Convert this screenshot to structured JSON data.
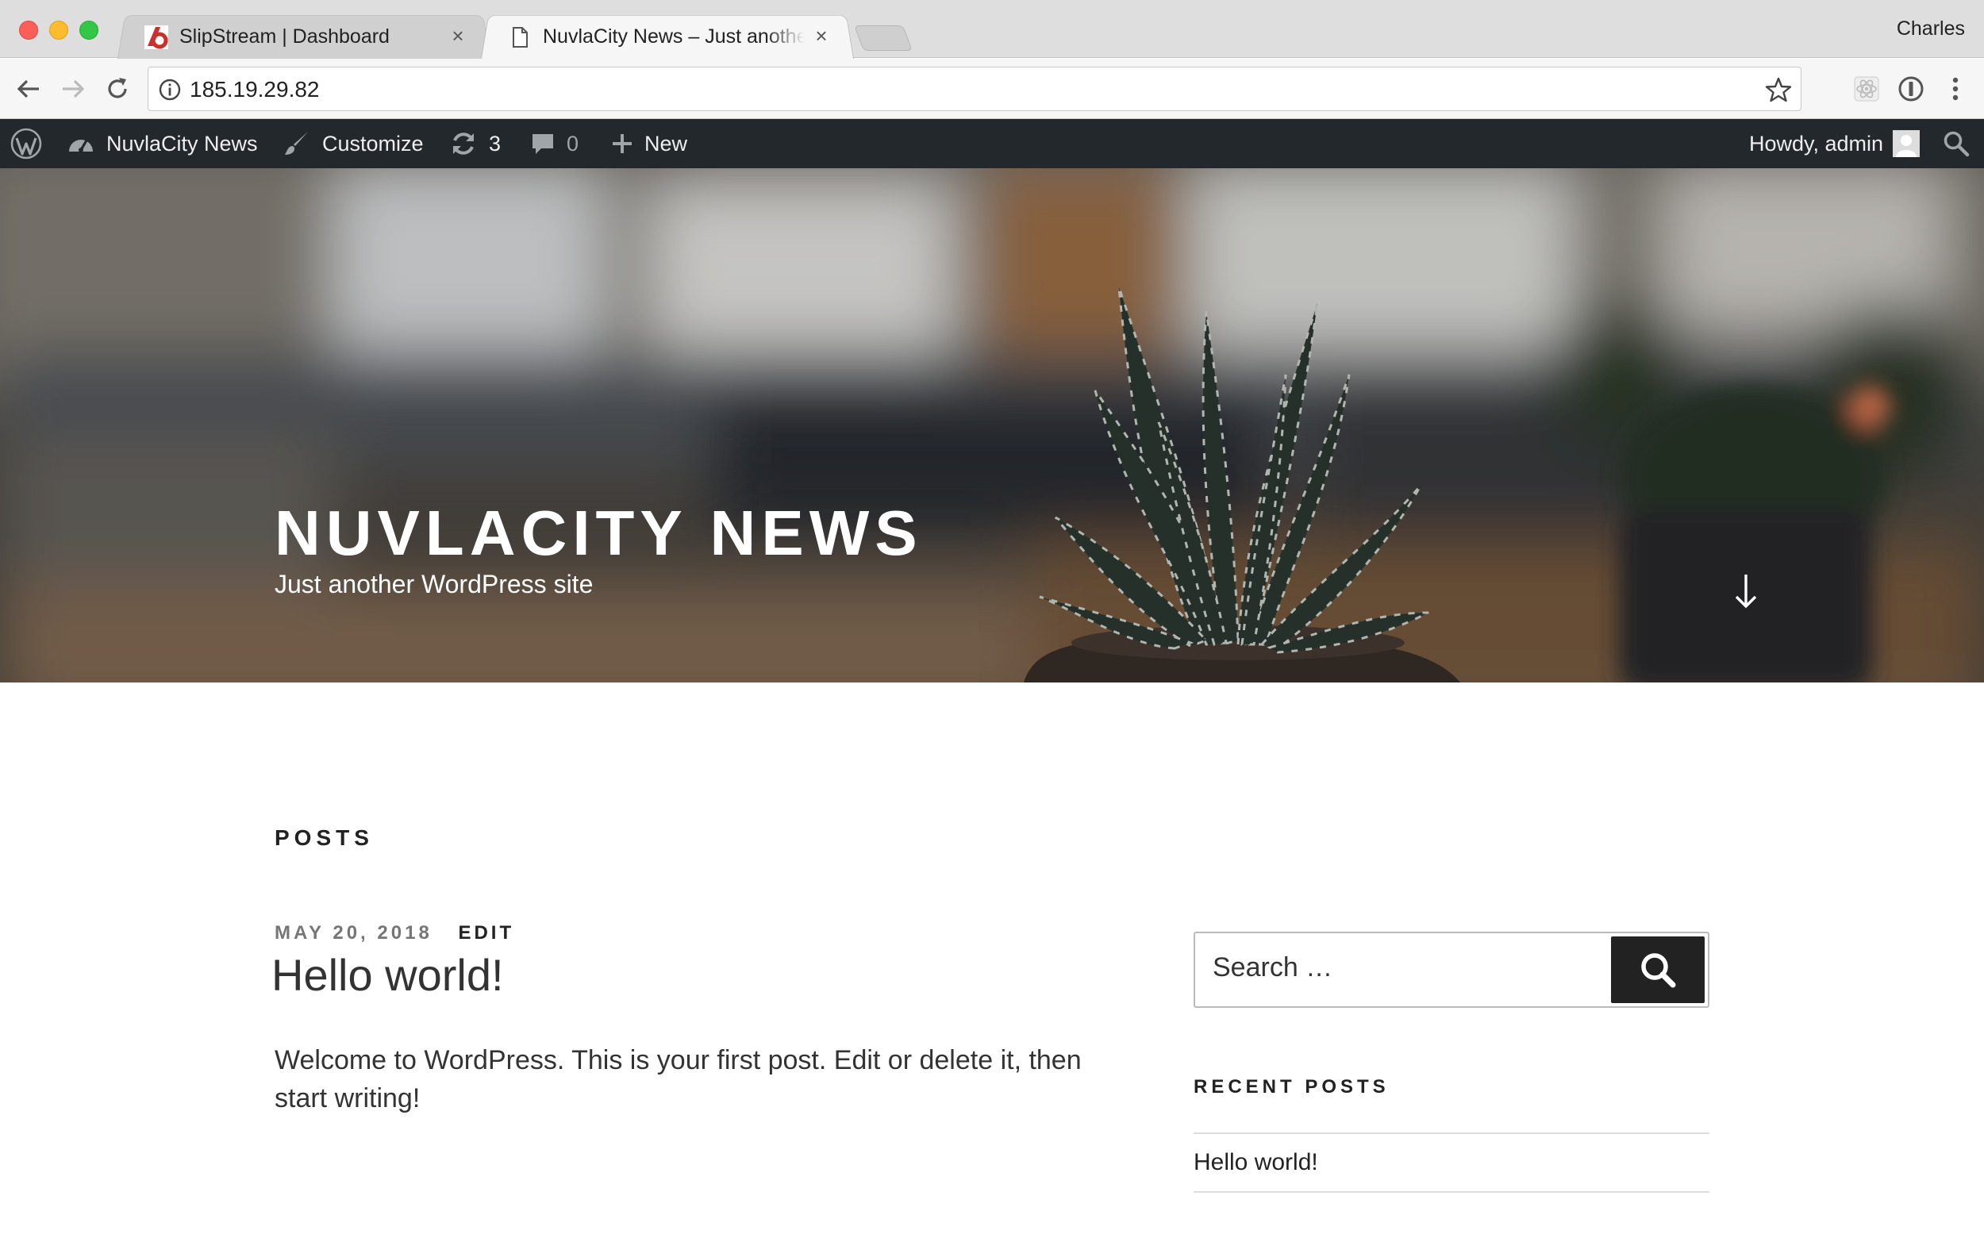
{
  "browser": {
    "tabs": [
      {
        "title": "SlipStream | Dashboard",
        "active": false,
        "favicon": "slipstream-logo"
      },
      {
        "title": "NuvlaCity News – Just another WordPress site",
        "active": true,
        "favicon": "page-icon"
      }
    ],
    "close_glyph": "×",
    "profile_name": "Charles",
    "url": "185.19.29.82"
  },
  "adminbar": {
    "site_name": "NuvlaCity News",
    "customize": "Customize",
    "updates_count": "3",
    "comments_count": "0",
    "new_label": "New",
    "howdy": "Howdy, admin"
  },
  "header": {
    "site_title": "NuvlaCity News",
    "tagline": "Just another WordPress site"
  },
  "main": {
    "page_heading": "Posts",
    "post": {
      "date": "May 20, 2018",
      "edit_label": "Edit",
      "title": "Hello world!",
      "excerpt": "Welcome to WordPress. This is your first post. Edit or delete it, then start writing!"
    }
  },
  "sidebar": {
    "search_placeholder": "Search …",
    "recent_posts_title": "Recent Posts",
    "recent_posts": [
      "Hello world!"
    ]
  },
  "colors": {
    "adminbar_bg": "#23282d",
    "accent_dark": "#222222"
  }
}
